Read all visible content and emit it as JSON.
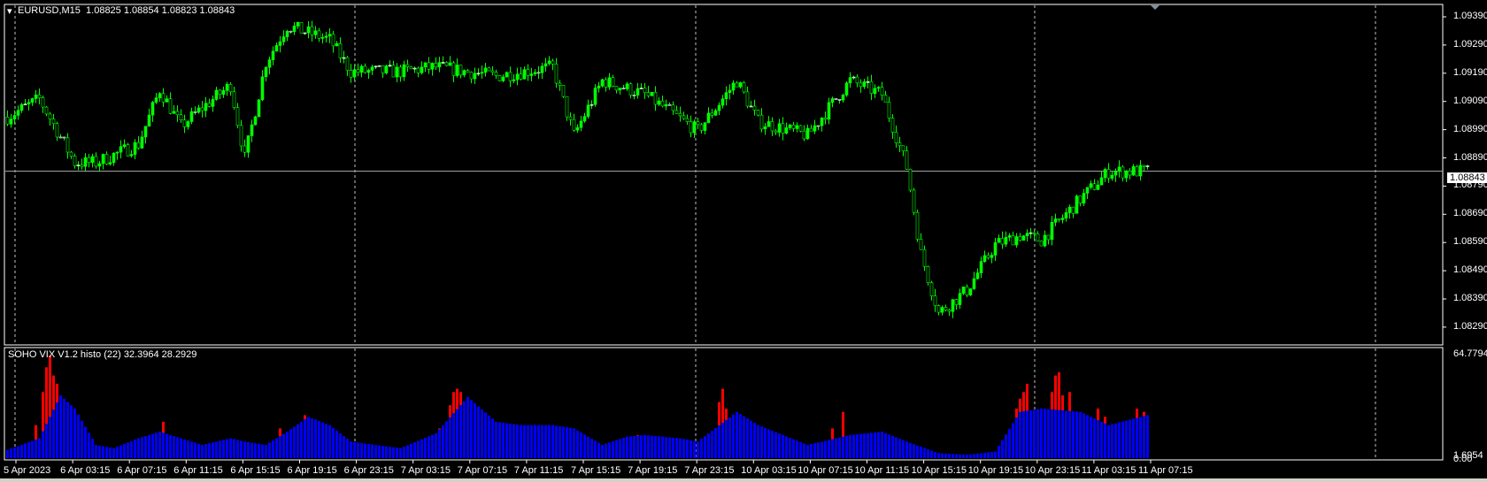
{
  "header": {
    "symbol": "EURUSD,M15",
    "ohlc": "1.08825 1.08854 1.08823 1.08843"
  },
  "indicator": {
    "title": "SOHO VIX V1.2 histo (22) 32.3964 28.2929",
    "scale_top": "64.7794",
    "scale_bottom": "1.6954",
    "scale_zero": "0.00"
  },
  "bid_label": "1.08843",
  "colors": {
    "bull": "#00ff00",
    "grid": "#c0c0c0",
    "blue": "#0000ff",
    "red": "#ff0000"
  },
  "chart_data": {
    "type": "candlestick",
    "price_labels": [
      "1.09390",
      "1.09290",
      "1.09190",
      "1.09090",
      "1.08990",
      "1.08890",
      "1.08790",
      "1.08690",
      "1.08590",
      "1.08490",
      "1.08390",
      "1.08290"
    ],
    "price_range": [
      1.0829,
      1.0939
    ],
    "bid": 1.08843,
    "time_labels": [
      "5 Apr 2023",
      "6 Apr 03:15",
      "6 Apr 07:15",
      "6 Apr 11:15",
      "6 Apr 15:15",
      "6 Apr 19:15",
      "6 Apr 23:15",
      "7 Apr 03:15",
      "7 Apr 07:15",
      "7 Apr 11:15",
      "7 Apr 15:15",
      "7 Apr 19:15",
      "7 Apr 23:15",
      "10 Apr 03:15",
      "10 Apr 07:15",
      "10 Apr 11:15",
      "10 Apr 15:15",
      "10 Apr 19:15",
      "10 Apr 23:15",
      "11 Apr 03:15",
      "11 Apr 07:15"
    ],
    "bars": 323,
    "close_keypoints": [
      [
        0,
        1.09035
      ],
      [
        9,
        1.09099
      ],
      [
        19,
        1.08873
      ],
      [
        25,
        1.08873
      ],
      [
        37,
        1.08938
      ],
      [
        43,
        1.09132
      ],
      [
        49,
        1.09002
      ],
      [
        55,
        1.09067
      ],
      [
        63,
        1.09148
      ],
      [
        67,
        1.08889
      ],
      [
        73,
        1.09229
      ],
      [
        79,
        1.09358
      ],
      [
        91,
        1.09309
      ],
      [
        97,
        1.09196
      ],
      [
        111,
        1.09196
      ],
      [
        121,
        1.09212
      ],
      [
        138,
        1.0918
      ],
      [
        154,
        1.09212
      ],
      [
        160,
        1.0897
      ],
      [
        168,
        1.09164
      ],
      [
        180,
        1.09115
      ],
      [
        195,
        1.08986
      ],
      [
        206,
        1.09164
      ],
      [
        212,
        1.09019
      ],
      [
        226,
        1.0897
      ],
      [
        238,
        1.09164
      ],
      [
        247,
        1.09115
      ],
      [
        254,
        1.08857
      ],
      [
        258,
        1.0855
      ],
      [
        263,
        1.0834
      ],
      [
        271,
        1.08421
      ],
      [
        279,
        1.08583
      ],
      [
        286,
        1.08615
      ],
      [
        292,
        1.08599
      ],
      [
        303,
        1.08744
      ],
      [
        311,
        1.08841
      ],
      [
        322,
        1.08843
      ]
    ],
    "vix_range": [
      0,
      64.7794
    ],
    "vix_blue_keypoints": [
      [
        0,
        5
      ],
      [
        9,
        12
      ],
      [
        15,
        38
      ],
      [
        19,
        30
      ],
      [
        25,
        8
      ],
      [
        30,
        6
      ],
      [
        37,
        12
      ],
      [
        43,
        16
      ],
      [
        49,
        12
      ],
      [
        55,
        8
      ],
      [
        63,
        12
      ],
      [
        67,
        10
      ],
      [
        73,
        8
      ],
      [
        79,
        16
      ],
      [
        85,
        25
      ],
      [
        91,
        20
      ],
      [
        97,
        10
      ],
      [
        111,
        6
      ],
      [
        121,
        15
      ],
      [
        130,
        37
      ],
      [
        138,
        22
      ],
      [
        145,
        20
      ],
      [
        154,
        20
      ],
      [
        160,
        18
      ],
      [
        168,
        8
      ],
      [
        175,
        13
      ],
      [
        180,
        14
      ],
      [
        190,
        12
      ],
      [
        195,
        10
      ],
      [
        206,
        28
      ],
      [
        212,
        20
      ],
      [
        226,
        8
      ],
      [
        238,
        14
      ],
      [
        247,
        16
      ],
      [
        254,
        10
      ],
      [
        263,
        3
      ],
      [
        271,
        2
      ],
      [
        279,
        4
      ],
      [
        286,
        28
      ],
      [
        292,
        30
      ],
      [
        303,
        28
      ],
      [
        311,
        20
      ],
      [
        322,
        26
      ]
    ],
    "vix_red_spikes": [
      [
        8,
        20
      ],
      [
        10,
        40
      ],
      [
        11,
        55
      ],
      [
        12,
        62
      ],
      [
        13,
        50
      ],
      [
        14,
        45
      ],
      [
        44,
        22
      ],
      [
        77,
        18
      ],
      [
        84,
        26
      ],
      [
        122,
        18
      ],
      [
        125,
        32
      ],
      [
        126,
        40
      ],
      [
        127,
        42
      ],
      [
        128,
        40
      ],
      [
        140,
        14
      ],
      [
        153,
        15
      ],
      [
        178,
        14
      ],
      [
        201,
        34
      ],
      [
        202,
        42
      ],
      [
        203,
        30
      ],
      [
        233,
        18
      ],
      [
        236,
        28
      ],
      [
        285,
        30
      ],
      [
        286,
        36
      ],
      [
        287,
        40
      ],
      [
        288,
        45
      ],
      [
        295,
        40
      ],
      [
        296,
        50
      ],
      [
        297,
        52
      ],
      [
        298,
        38
      ],
      [
        300,
        40
      ],
      [
        308,
        30
      ],
      [
        310,
        25
      ],
      [
        319,
        30
      ],
      [
        321,
        28
      ]
    ]
  }
}
